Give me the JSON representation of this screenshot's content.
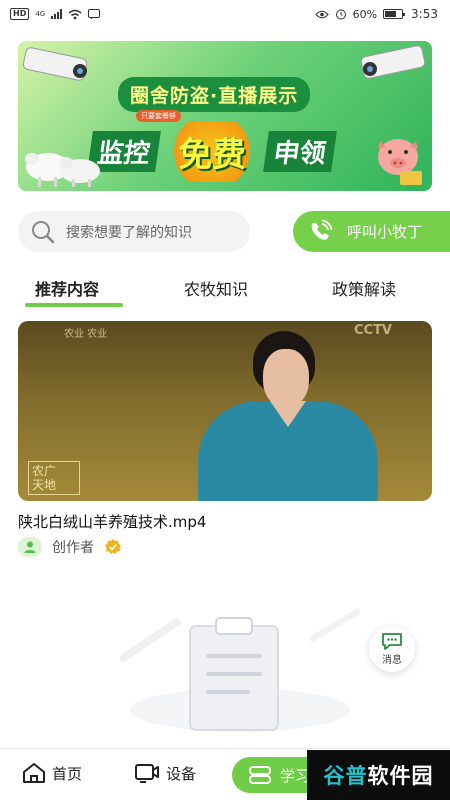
{
  "status_bar": {
    "network_badge": "HD",
    "network_type": "4G",
    "battery_percent": "60%",
    "time": "3:53"
  },
  "banner": {
    "title": "圈舍防盗·直播展示",
    "tag": "只要套餐够",
    "slogan_left": "监控",
    "slogan_middle": "免费",
    "slogan_right": "申领"
  },
  "search": {
    "placeholder": "搜索想要了解的知识"
  },
  "call_button": {
    "label": "呼叫小牧丁"
  },
  "tabs": [
    {
      "label": "推荐内容",
      "active": true
    },
    {
      "label": "农牧知识",
      "active": false
    },
    {
      "label": "政策解读",
      "active": false
    }
  ],
  "video": {
    "overlay_top_left": "农业 农业",
    "overlay_top_right": "CCTV",
    "corner_label_line1": "农广",
    "corner_label_line2": "天地",
    "title": "陕北白绒山羊养殖技术.mp4",
    "author": "创作者"
  },
  "floating_message": {
    "label": "消息"
  },
  "bottom_nav": {
    "home": "首页",
    "device": "设备",
    "study": "学习"
  },
  "watermark": {
    "part1": "谷普",
    "part2": "软件园"
  },
  "colors": {
    "accent_green": "#6fcd47",
    "call_green": "#76d04a"
  }
}
